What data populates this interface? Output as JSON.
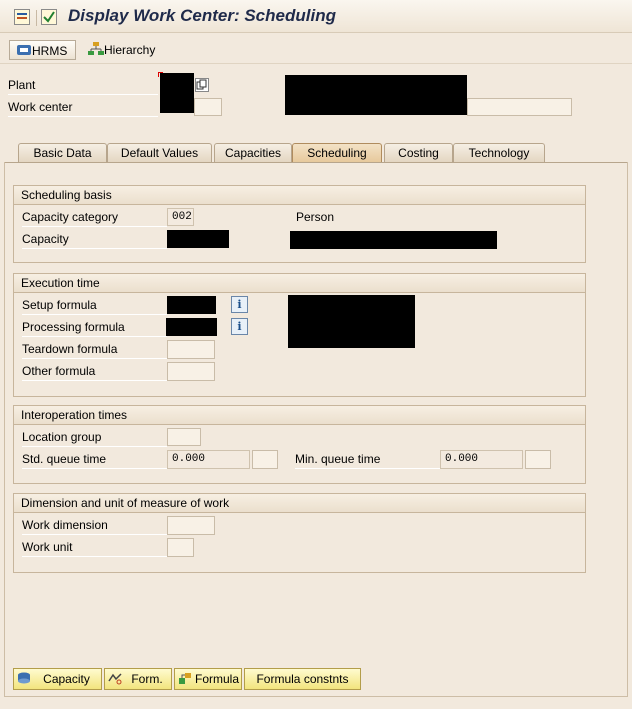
{
  "window": {
    "title": "Display Work Center: Scheduling"
  },
  "toolbar": {
    "hrms_label": "HRMS",
    "hierarchy_label": "Hierarchy"
  },
  "header": {
    "plant_label": "Plant",
    "work_center_label": "Work center"
  },
  "tabs": [
    {
      "label": "Basic Data"
    },
    {
      "label": "Default Values"
    },
    {
      "label": "Capacities"
    },
    {
      "label": "Scheduling"
    },
    {
      "label": "Costing"
    },
    {
      "label": "Technology"
    }
  ],
  "scheduling_basis": {
    "title": "Scheduling basis",
    "capacity_category_label": "Capacity category",
    "capacity_category_value": "002",
    "capacity_category_text": "Person",
    "capacity_label": "Capacity"
  },
  "execution_time": {
    "title": "Execution time",
    "setup_label": "Setup formula",
    "processing_label": "Processing formula",
    "teardown_label": "Teardown formula",
    "other_label": "Other formula"
  },
  "interoperation": {
    "title": "Interoperation times",
    "location_group_label": "Location group",
    "std_queue_label": "Std. queue time",
    "std_queue_value": "0.000",
    "min_queue_label": "Min. queue time",
    "min_queue_value": "0.000"
  },
  "dimension": {
    "title": "Dimension and unit of measure of work",
    "work_dimension_label": "Work dimension",
    "work_unit_label": "Work unit"
  },
  "bottom_buttons": {
    "capacity": "Capacity",
    "form": "Form.",
    "formula": "Formula",
    "formula_constants": "Formula constnts"
  }
}
